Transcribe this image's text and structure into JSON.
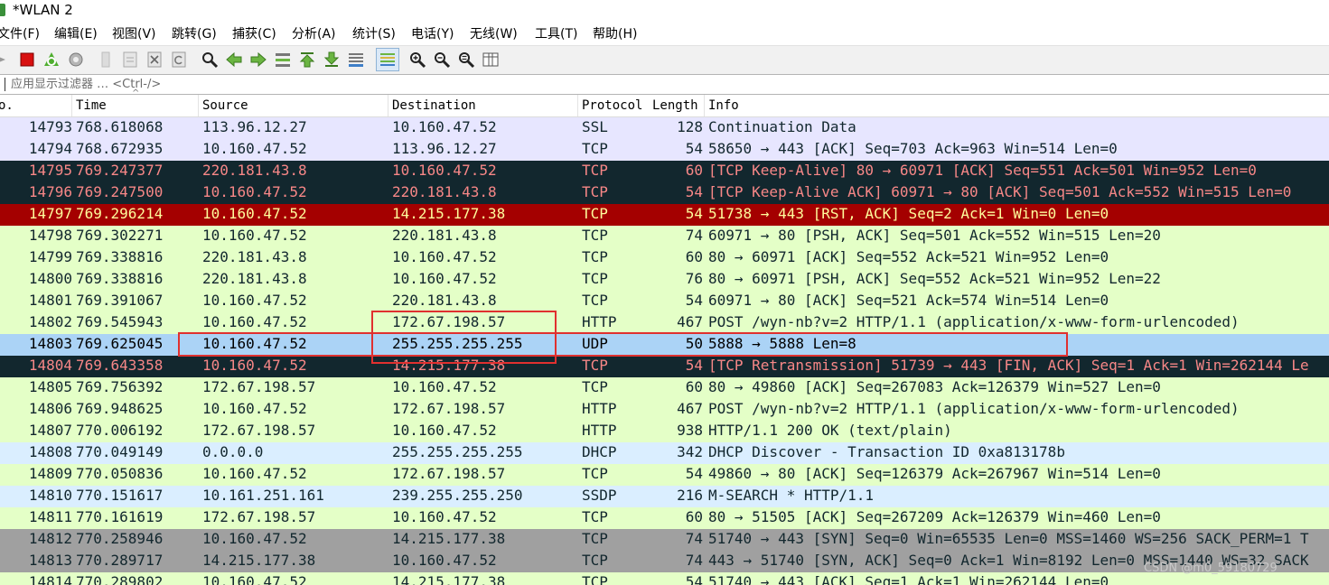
{
  "window": {
    "title": "*WLAN 2"
  },
  "menu": [
    "文件(F)",
    "编辑(E)",
    "视图(V)",
    "跳转(G)",
    "捕获(C)",
    "分析(A)",
    "统计(S)",
    "电话(Y)",
    "无线(W)",
    "工具(T)",
    "帮助(H)"
  ],
  "toolbar": {
    "icons": [
      "start-capture-icon",
      "stop-capture-icon",
      "restart-capture-icon",
      "capture-options-icon",
      "open-file-icon",
      "save-file-icon",
      "close-file-icon",
      "reload-file-icon",
      "find-packet-icon",
      "go-back-icon",
      "go-forward-icon",
      "go-to-packet-icon",
      "go-first-packet-icon",
      "go-last-packet-icon",
      "autoscroll-icon",
      "colorize-icon",
      "zoom-in-icon",
      "zoom-out-icon",
      "normal-size-icon",
      "resize-columns-icon"
    ]
  },
  "filter": {
    "placeholder": "应用显示过滤器 … <Ctrl-/>"
  },
  "columns": {
    "no": "o.",
    "time": "Time",
    "source": "Source",
    "destination": "Destination",
    "protocol": "Protocol",
    "length": "Length",
    "info": "Info"
  },
  "colors": {
    "ssl": "#e7e6ff",
    "tcp": "#e7e6ff",
    "http": "#e4ffc7",
    "udp": "#daeeff",
    "dhcp": "#daeeff",
    "ssdp": "#daeeff",
    "bad_bg": "#12272e",
    "bad_fg": "#f78787",
    "rst_bg": "#a40000",
    "rst_fg": "#fffc9c",
    "syn_bg": "#a0a0a0",
    "selected": "#abd3f6",
    "highlight_box": "#e0302f"
  },
  "packets": [
    {
      "no": "14793",
      "time": "768.618068",
      "src": "113.96.12.27",
      "dst": "10.160.47.52",
      "proto": "SSL",
      "len": "128",
      "info": "Continuation Data",
      "color": "ssl"
    },
    {
      "no": "14794",
      "time": "768.672935",
      "src": "10.160.47.52",
      "dst": "113.96.12.27",
      "proto": "TCP",
      "len": "54",
      "info": "58650 → 443 [ACK] Seq=703 Ack=963 Win=514 Len=0",
      "color": "tcp"
    },
    {
      "no": "14795",
      "time": "769.247377",
      "src": "220.181.43.8",
      "dst": "10.160.47.52",
      "proto": "TCP",
      "len": "60",
      "info": "[TCP Keep-Alive] 80 → 60971 [ACK] Seq=551 Ack=501 Win=952 Len=0",
      "color": "bad"
    },
    {
      "no": "14796",
      "time": "769.247500",
      "src": "10.160.47.52",
      "dst": "220.181.43.8",
      "proto": "TCP",
      "len": "54",
      "info": "[TCP Keep-Alive ACK] 60971 → 80 [ACK] Seq=501 Ack=552 Win=515 Len=0",
      "color": "bad"
    },
    {
      "no": "14797",
      "time": "769.296214",
      "src": "10.160.47.52",
      "dst": "14.215.177.38",
      "proto": "TCP",
      "len": "54",
      "info": "51738 → 443 [RST, ACK] Seq=2 Ack=1 Win=0 Len=0",
      "color": "rst"
    },
    {
      "no": "14798",
      "time": "769.302271",
      "src": "10.160.47.52",
      "dst": "220.181.43.8",
      "proto": "TCP",
      "len": "74",
      "info": "60971 → 80 [PSH, ACK] Seq=501 Ack=552 Win=515 Len=20",
      "color": "http"
    },
    {
      "no": "14799",
      "time": "769.338816",
      "src": "220.181.43.8",
      "dst": "10.160.47.52",
      "proto": "TCP",
      "len": "60",
      "info": "80 → 60971 [ACK] Seq=552 Ack=521 Win=952 Len=0",
      "color": "http"
    },
    {
      "no": "14800",
      "time": "769.338816",
      "src": "220.181.43.8",
      "dst": "10.160.47.52",
      "proto": "TCP",
      "len": "76",
      "info": "80 → 60971 [PSH, ACK] Seq=552 Ack=521 Win=952 Len=22",
      "color": "http"
    },
    {
      "no": "14801",
      "time": "769.391067",
      "src": "10.160.47.52",
      "dst": "220.181.43.8",
      "proto": "TCP",
      "len": "54",
      "info": "60971 → 80 [ACK] Seq=521 Ack=574 Win=514 Len=0",
      "color": "http"
    },
    {
      "no": "14802",
      "time": "769.545943",
      "src": "10.160.47.52",
      "dst": "172.67.198.57",
      "proto": "HTTP",
      "len": "467",
      "info": "POST /wyn-nb?v=2 HTTP/1.1  (application/x-www-form-urlencoded)",
      "color": "http"
    },
    {
      "no": "14803",
      "time": "769.625045",
      "src": "10.160.47.52",
      "dst": "255.255.255.255",
      "proto": "UDP",
      "len": "50",
      "info": "5888 → 5888 Len=8",
      "color": "selected"
    },
    {
      "no": "14804",
      "time": "769.643358",
      "src": "10.160.47.52",
      "dst": "14.215.177.38",
      "proto": "TCP",
      "len": "54",
      "info": "[TCP Retransmission] 51739 → 443 [FIN, ACK] Seq=1 Ack=1 Win=262144 Le",
      "color": "bad"
    },
    {
      "no": "14805",
      "time": "769.756392",
      "src": "172.67.198.57",
      "dst": "10.160.47.52",
      "proto": "TCP",
      "len": "60",
      "info": "80 → 49860 [ACK] Seq=267083 Ack=126379 Win=527 Len=0",
      "color": "http"
    },
    {
      "no": "14806",
      "time": "769.948625",
      "src": "10.160.47.52",
      "dst": "172.67.198.57",
      "proto": "HTTP",
      "len": "467",
      "info": "POST /wyn-nb?v=2 HTTP/1.1  (application/x-www-form-urlencoded)",
      "color": "http"
    },
    {
      "no": "14807",
      "time": "770.006192",
      "src": "172.67.198.57",
      "dst": "10.160.47.52",
      "proto": "HTTP",
      "len": "938",
      "info": "HTTP/1.1 200 OK  (text/plain)",
      "color": "http"
    },
    {
      "no": "14808",
      "time": "770.049149",
      "src": "0.0.0.0",
      "dst": "255.255.255.255",
      "proto": "DHCP",
      "len": "342",
      "info": "DHCP Discover - Transaction ID 0xa813178b",
      "color": "dhcp"
    },
    {
      "no": "14809",
      "time": "770.050836",
      "src": "10.160.47.52",
      "dst": "172.67.198.57",
      "proto": "TCP",
      "len": "54",
      "info": "49860 → 80 [ACK] Seq=126379 Ack=267967 Win=514 Len=0",
      "color": "http"
    },
    {
      "no": "14810",
      "time": "770.151617",
      "src": "10.161.251.161",
      "dst": "239.255.255.250",
      "proto": "SSDP",
      "len": "216",
      "info": "M-SEARCH * HTTP/1.1",
      "color": "ssdp"
    },
    {
      "no": "14811",
      "time": "770.161619",
      "src": "172.67.198.57",
      "dst": "10.160.47.52",
      "proto": "TCP",
      "len": "60",
      "info": "80 → 51505 [ACK] Seq=267209 Ack=126379 Win=460 Len=0",
      "color": "http"
    },
    {
      "no": "14812",
      "time": "770.258946",
      "src": "10.160.47.52",
      "dst": "14.215.177.38",
      "proto": "TCP",
      "len": "74",
      "info": "51740 → 443 [SYN] Seq=0 Win=65535 Len=0 MSS=1460 WS=256 SACK_PERM=1 T",
      "color": "syn"
    },
    {
      "no": "14813",
      "time": "770.289717",
      "src": "14.215.177.38",
      "dst": "10.160.47.52",
      "proto": "TCP",
      "len": "74",
      "info": "443 → 51740 [SYN, ACK] Seq=0 Ack=1 Win=8192 Len=0 MSS=1440 WS=32 SACK",
      "color": "syn"
    },
    {
      "no": "14814",
      "time": "770.289802",
      "src": "10.160.47.52",
      "dst": "14.215.177.38",
      "proto": "TCP",
      "len": "54",
      "info": "51740 → 443 [ACK] Seq=1 Ack=1 Win=262144 Len=0",
      "color": "http"
    }
  ],
  "watermark": "CSDN @m0_59180729"
}
